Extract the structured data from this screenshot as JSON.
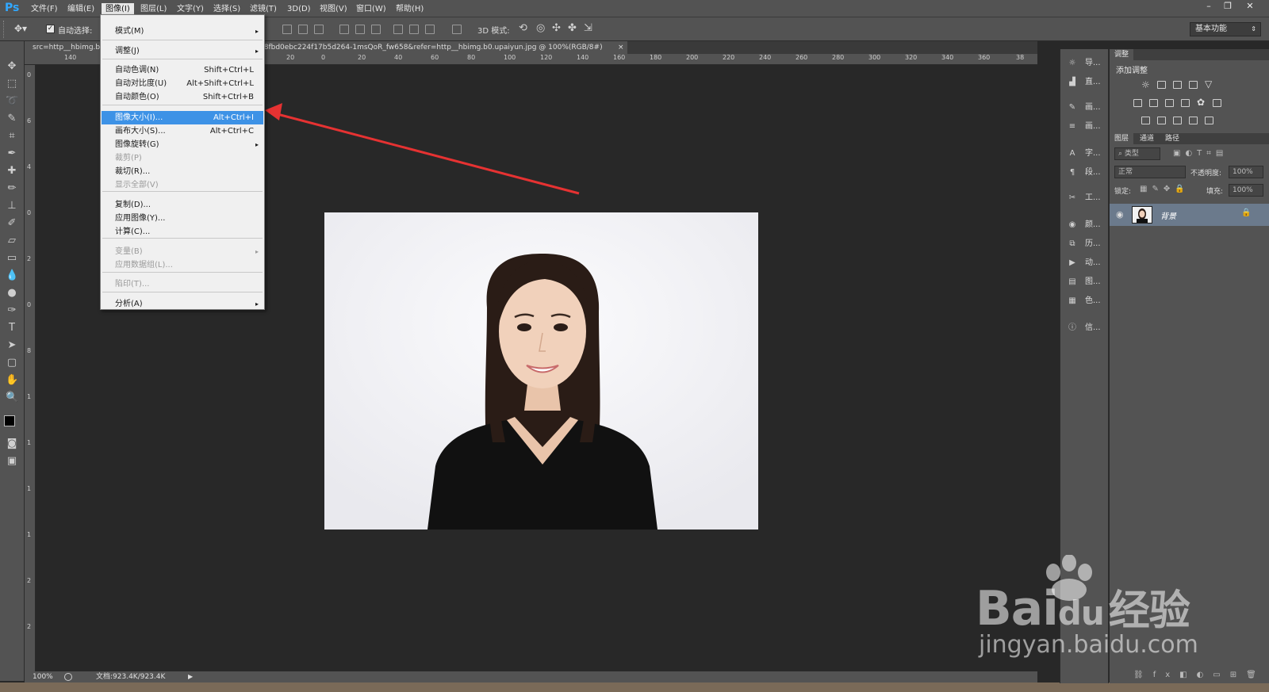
{
  "app": {
    "logo": "Ps"
  },
  "menubar": {
    "items": [
      {
        "label": "文件(F)"
      },
      {
        "label": "编辑(E)"
      },
      {
        "label": "图像(I)"
      },
      {
        "label": "图层(L)"
      },
      {
        "label": "文字(Y)"
      },
      {
        "label": "选择(S)"
      },
      {
        "label": "滤镜(T)"
      },
      {
        "label": "3D(D)"
      },
      {
        "label": "视图(V)"
      },
      {
        "label": "窗口(W)"
      },
      {
        "label": "帮助(H)"
      }
    ],
    "active_index": 2
  },
  "options_bar": {
    "auto_select_label": "自动选择:",
    "auto_select_checked": true,
    "mode_3d_label": "3D 模式:",
    "workspace": "基本功能"
  },
  "document": {
    "tab_left": "src=http__hbimg.b",
    "tab_title": "38fbd0ebc224f17b5d264-1msQoR_fw658&refer=http__hbimg.b0.upaiyun.jpg @ 100%(RGB/8#)",
    "close_glyph": "×",
    "ruler_top_ticks": [
      "140",
      "",
      "20",
      "0",
      "20",
      "40",
      "60",
      "80",
      "100",
      "120",
      "140",
      "160",
      "180",
      "200",
      "220",
      "240",
      "260",
      "280",
      "300",
      "320",
      "340",
      "360",
      "38"
    ],
    "ruler_left_ticks": [
      "0",
      "6",
      "4",
      "0",
      "2",
      "0",
      "8",
      "1",
      "1",
      "1",
      "1",
      "2",
      "2"
    ]
  },
  "image_menu": {
    "items": [
      {
        "label": "模式(M)",
        "shortcut": "",
        "submenu": true,
        "disabled": false
      },
      {
        "label": "调整(J)",
        "shortcut": "",
        "submenu": true,
        "disabled": false
      },
      {
        "label": "自动色调(N)",
        "shortcut": "Shift+Ctrl+L",
        "submenu": false,
        "disabled": false
      },
      {
        "label": "自动对比度(U)",
        "shortcut": "Alt+Shift+Ctrl+L",
        "submenu": false,
        "disabled": false
      },
      {
        "label": "自动颜色(O)",
        "shortcut": "Shift+Ctrl+B",
        "submenu": false,
        "disabled": false
      },
      {
        "label": "图像大小(I)...",
        "shortcut": "Alt+Ctrl+I",
        "submenu": false,
        "disabled": false,
        "highlighted": true
      },
      {
        "label": "画布大小(S)...",
        "shortcut": "Alt+Ctrl+C",
        "submenu": false,
        "disabled": false
      },
      {
        "label": "图像旋转(G)",
        "shortcut": "",
        "submenu": true,
        "disabled": false
      },
      {
        "label": "裁剪(P)",
        "shortcut": "",
        "submenu": false,
        "disabled": true
      },
      {
        "label": "裁切(R)...",
        "shortcut": "",
        "submenu": false,
        "disabled": false
      },
      {
        "label": "显示全部(V)",
        "shortcut": "",
        "submenu": false,
        "disabled": true
      },
      {
        "label": "复制(D)...",
        "shortcut": "",
        "submenu": false,
        "disabled": false
      },
      {
        "label": "应用图像(Y)...",
        "shortcut": "",
        "submenu": false,
        "disabled": false
      },
      {
        "label": "计算(C)...",
        "shortcut": "",
        "submenu": false,
        "disabled": false
      },
      {
        "label": "变量(B)",
        "shortcut": "",
        "submenu": true,
        "disabled": true
      },
      {
        "label": "应用数据组(L)...",
        "shortcut": "",
        "submenu": false,
        "disabled": true
      },
      {
        "label": "陷印(T)...",
        "shortcut": "",
        "submenu": false,
        "disabled": true
      },
      {
        "label": "分析(A)",
        "shortcut": "",
        "submenu": true,
        "disabled": false
      }
    ],
    "submenu_glyph": "▸"
  },
  "icon_panel": {
    "items": [
      {
        "label": "导..."
      },
      {
        "label": "直..."
      },
      {
        "label": "画..."
      },
      {
        "label": "画..."
      },
      {
        "label": "字..."
      },
      {
        "label": "段..."
      },
      {
        "label": "工..."
      },
      {
        "label": "颜..."
      },
      {
        "label": "历..."
      },
      {
        "label": "动..."
      },
      {
        "label": "图..."
      },
      {
        "label": "色..."
      },
      {
        "label": "信..."
      }
    ]
  },
  "adjustments_panel": {
    "tab": "调整",
    "title": "添加调整"
  },
  "layers_panel": {
    "tabs": [
      "图层",
      "通道",
      "路径"
    ],
    "filter_kind": "类型",
    "blend_mode": "正常",
    "opacity_label": "不透明度:",
    "opacity_value": "100%",
    "lock_label": "锁定:",
    "fill_label": "填充:",
    "fill_value": "100%",
    "layers": [
      {
        "name": "背景",
        "locked": true,
        "visible": true
      }
    ]
  },
  "status_bar": {
    "zoom": "100%",
    "doc_size": "文档:923.4K/923.4K"
  },
  "watermark": {
    "brand_left": "Bai",
    "brand_mid": "du",
    "brand_right": "经验",
    "url": "jingyan.baidu.com"
  },
  "colors": {
    "arrow": "#e63232",
    "menu_highlight": "#3d92e6",
    "panel_bg": "#535353",
    "canvas_bg": "#282828"
  }
}
